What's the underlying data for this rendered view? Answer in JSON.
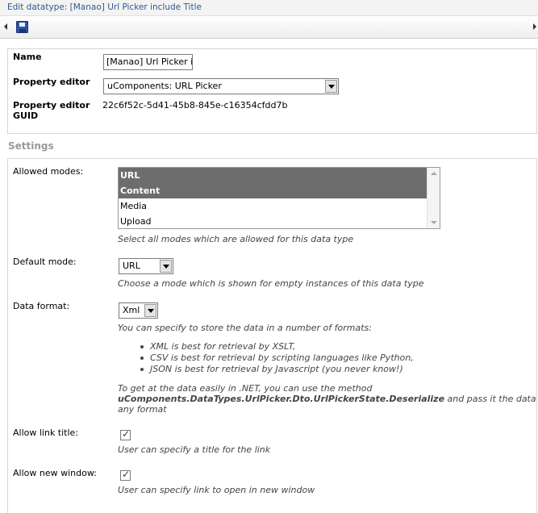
{
  "window": {
    "title": "Edit datatype: [Manao] Url Picker include Title"
  },
  "toolbar": {
    "save_icon": "floppy-disk-icon"
  },
  "general": {
    "name_label": "Name",
    "name_value": "[Manao] Url Picker inc",
    "editor_label": "Property editor",
    "editor_value": "uComponents: URL Picker",
    "guid_label_1": "Property editor",
    "guid_label_2": "GUID",
    "guid_value": "22c6f52c-5d41-45b8-845e-c16354cfdd7b"
  },
  "settings": {
    "heading": "Settings",
    "allowed_modes": {
      "label": "Allowed modes:",
      "options": [
        {
          "label": "URL",
          "selected": true
        },
        {
          "label": "Content",
          "selected": true
        },
        {
          "label": "Media",
          "selected": false
        },
        {
          "label": "Upload",
          "selected": false
        }
      ],
      "hint": "Select all modes which are allowed for this data type"
    },
    "default_mode": {
      "label": "Default mode:",
      "value": "URL",
      "hint": "Choose a mode which is shown for empty instances of this data type"
    },
    "data_format": {
      "label": "Data format:",
      "value": "Xml",
      "hint": "You can specify to store the data in a number of formats:",
      "bullets": [
        "XML is best for retrieval by XSLT,",
        "CSV is best for retrieval by scripting languages like Python,",
        "JSON is best for retrieval by Javascript (you never know!)"
      ],
      "net_line1": "To get at the data easily in .NET, you can use the method",
      "net_method": "uComponents.DataTypes.UrlPicker.Dto.UrlPickerState.Deserialize",
      "net_line2_rest": " and pass it the data in",
      "net_line3": "any format"
    },
    "allow_link_title": {
      "label": "Allow link title:",
      "checked": true,
      "hint": "User can specify a title for the link"
    },
    "allow_new_window": {
      "label": "Allow new window:",
      "checked": true,
      "hint": "User can specify link to open in new window"
    }
  }
}
